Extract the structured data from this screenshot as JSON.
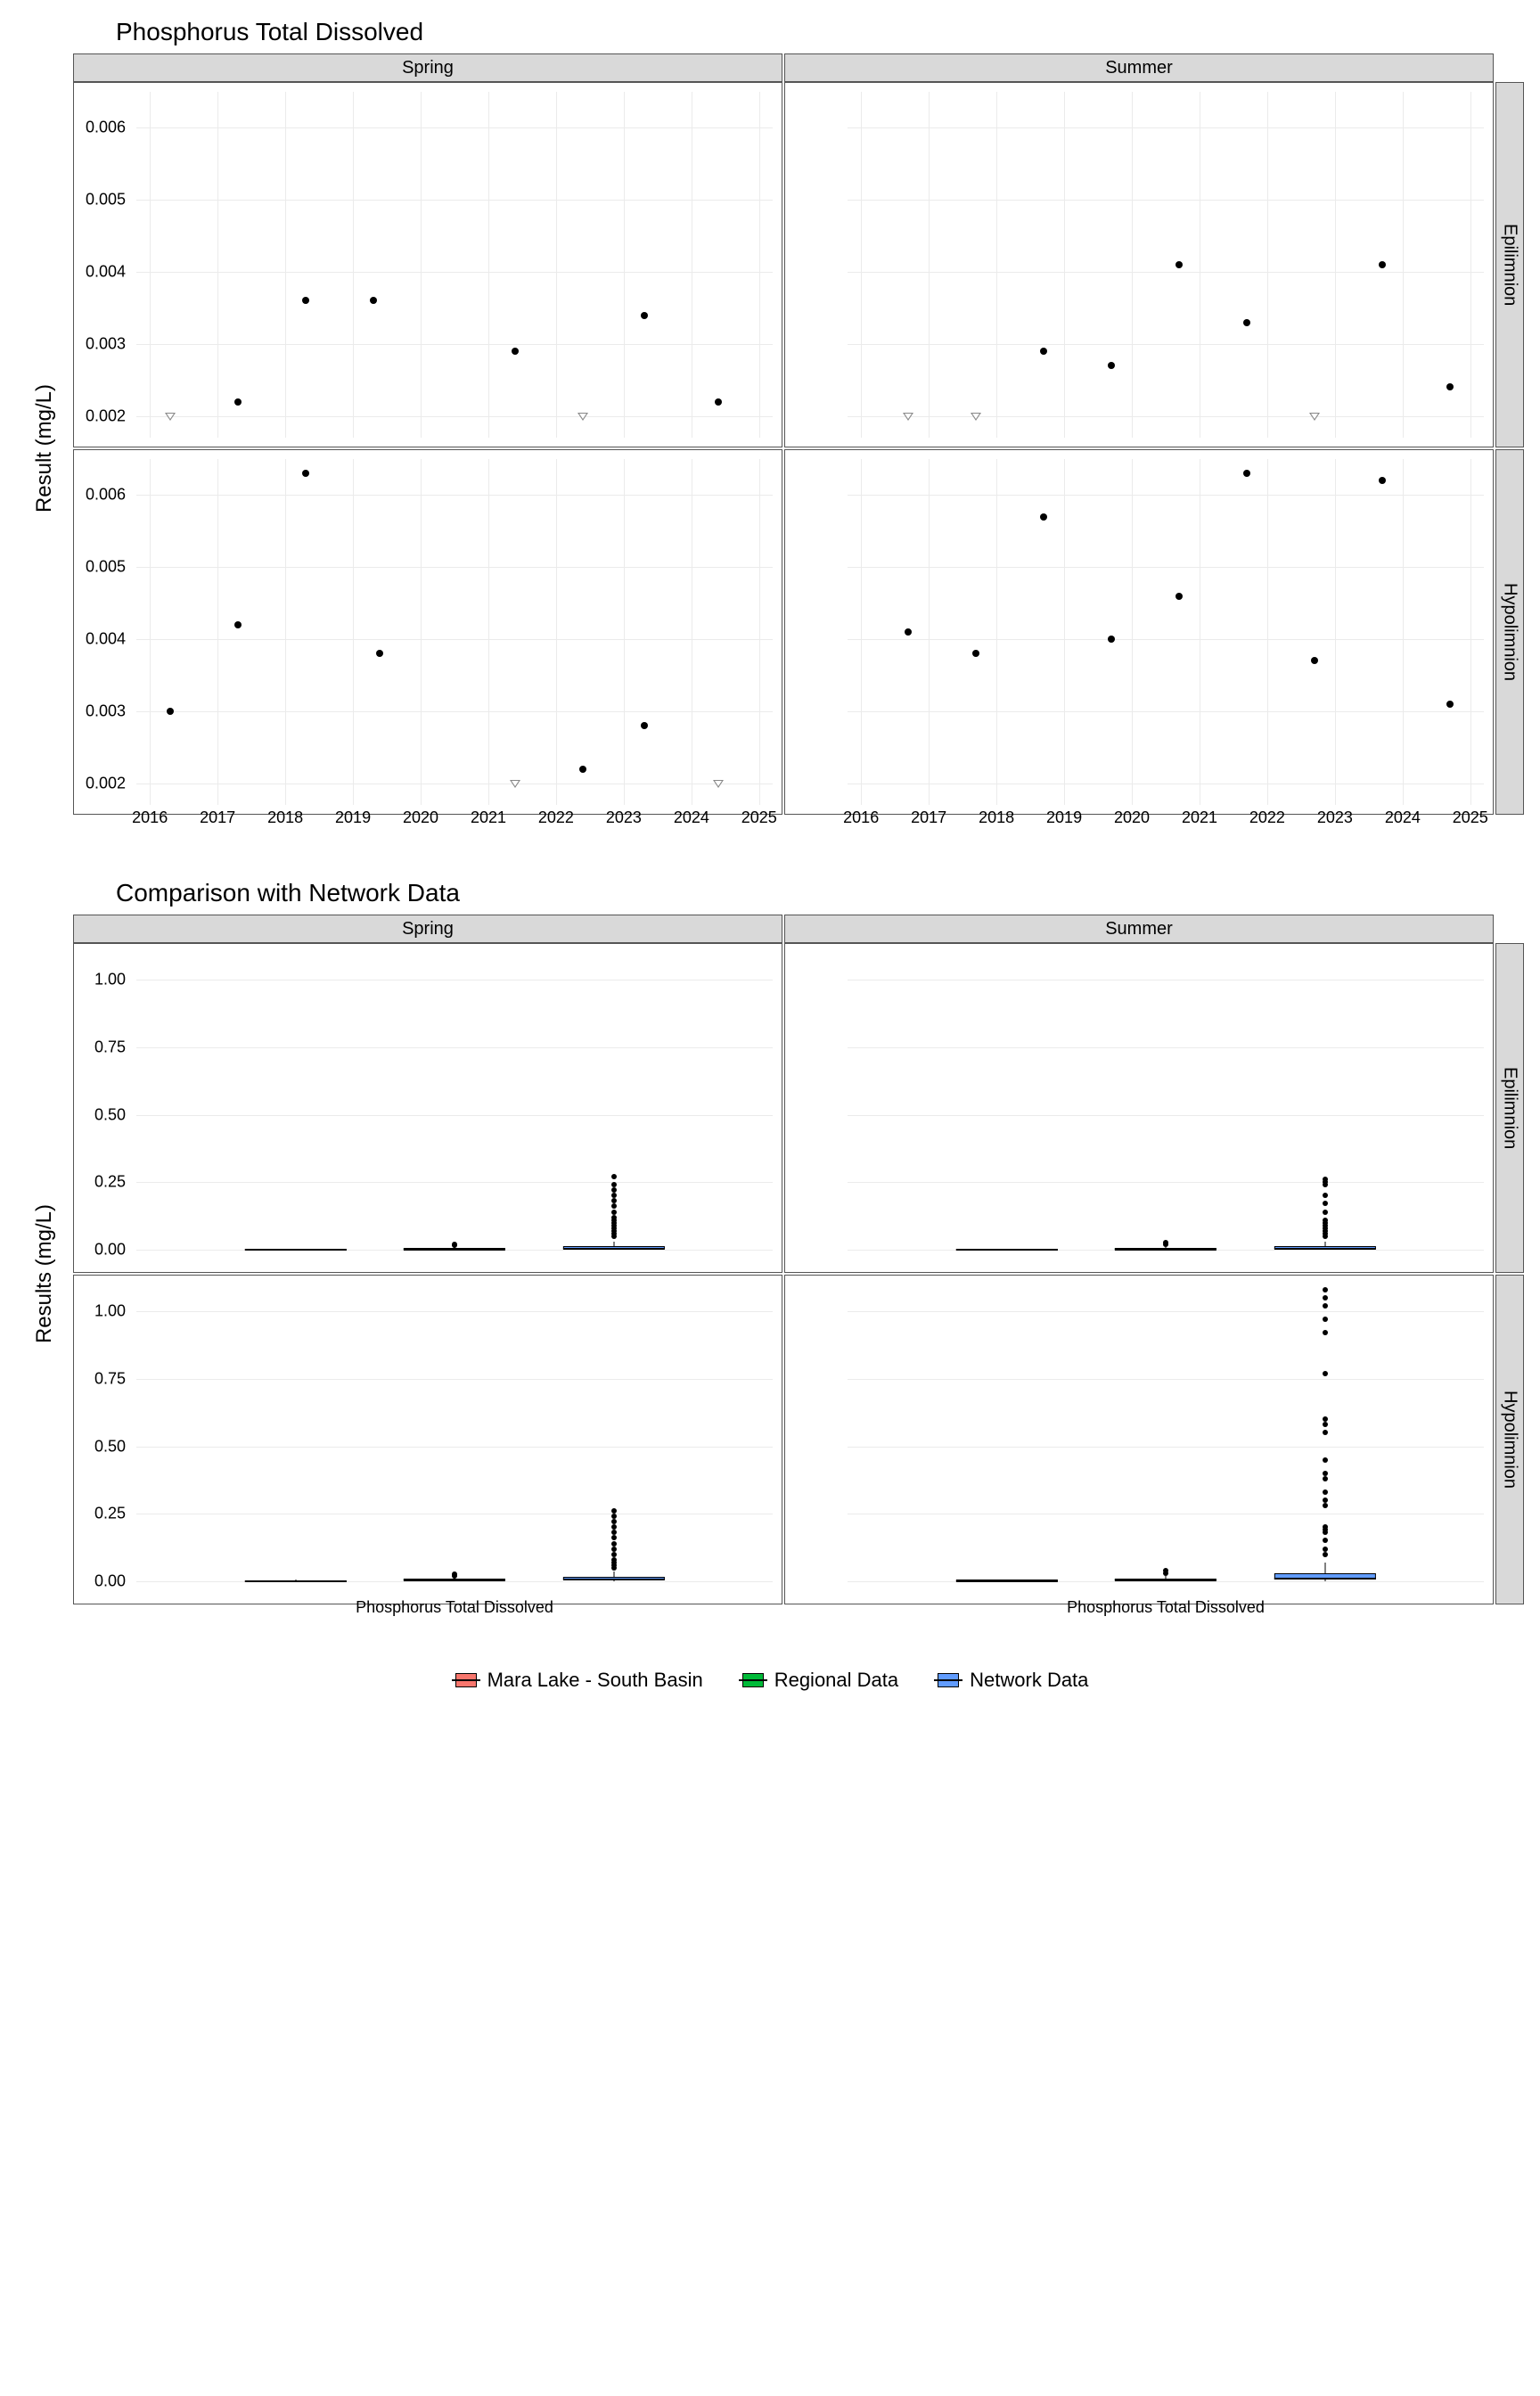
{
  "chart_data": [
    {
      "type": "scatter",
      "title": "Phosphorus Total Dissolved",
      "ylabel": "Result (mg/L)",
      "xlim": [
        2015.8,
        2025.2
      ],
      "x_ticks": [
        2016,
        2017,
        2018,
        2019,
        2020,
        2021,
        2022,
        2023,
        2024,
        2025
      ],
      "facets_cols": [
        "Spring",
        "Summer"
      ],
      "facets_rows": [
        "Epilimnion",
        "Hypolimnion"
      ],
      "ylim": [
        0.0017,
        0.0065
      ],
      "y_ticks": [
        0.002,
        0.003,
        0.004,
        0.005,
        0.006
      ],
      "panels": {
        "Spring|Epilimnion": {
          "points": [
            {
              "x": 2017.3,
              "y": 0.0022
            },
            {
              "x": 2018.3,
              "y": 0.0036
            },
            {
              "x": 2019.3,
              "y": 0.0036
            },
            {
              "x": 2021.4,
              "y": 0.0029
            },
            {
              "x": 2023.3,
              "y": 0.0034
            },
            {
              "x": 2024.4,
              "y": 0.0022
            }
          ],
          "censored": [
            {
              "x": 2016.3,
              "y": 0.002
            },
            {
              "x": 2022.4,
              "y": 0.002
            }
          ]
        },
        "Summer|Epilimnion": {
          "points": [
            {
              "x": 2018.7,
              "y": 0.0029
            },
            {
              "x": 2019.7,
              "y": 0.0027
            },
            {
              "x": 2020.7,
              "y": 0.0041
            },
            {
              "x": 2021.7,
              "y": 0.0033
            },
            {
              "x": 2023.7,
              "y": 0.0041
            },
            {
              "x": 2024.7,
              "y": 0.0024
            }
          ],
          "censored": [
            {
              "x": 2016.7,
              "y": 0.002
            },
            {
              "x": 2017.7,
              "y": 0.002
            },
            {
              "x": 2022.7,
              "y": 0.002
            }
          ]
        },
        "Spring|Hypolimnion": {
          "points": [
            {
              "x": 2016.3,
              "y": 0.003
            },
            {
              "x": 2017.3,
              "y": 0.0042
            },
            {
              "x": 2018.3,
              "y": 0.0063
            },
            {
              "x": 2019.4,
              "y": 0.0038
            },
            {
              "x": 2022.4,
              "y": 0.0022
            },
            {
              "x": 2023.3,
              "y": 0.0028
            }
          ],
          "censored": [
            {
              "x": 2021.4,
              "y": 0.002
            },
            {
              "x": 2024.4,
              "y": 0.002
            }
          ]
        },
        "Summer|Hypolimnion": {
          "points": [
            {
              "x": 2016.7,
              "y": 0.0041
            },
            {
              "x": 2017.7,
              "y": 0.0038
            },
            {
              "x": 2018.7,
              "y": 0.0057
            },
            {
              "x": 2019.7,
              "y": 0.004
            },
            {
              "x": 2020.7,
              "y": 0.0046
            },
            {
              "x": 2021.7,
              "y": 0.0063
            },
            {
              "x": 2022.7,
              "y": 0.0037
            },
            {
              "x": 2023.7,
              "y": 0.0062
            },
            {
              "x": 2024.7,
              "y": 0.0031
            }
          ],
          "censored": []
        }
      }
    },
    {
      "type": "boxplot",
      "title": "Comparison with Network Data",
      "ylabel": "Results (mg/L)",
      "x_category_label": "Phosphorus Total Dissolved",
      "facets_cols": [
        "Spring",
        "Summer"
      ],
      "facets_rows": [
        "Epilimnion",
        "Hypolimnion"
      ],
      "ylim": [
        -0.05,
        1.1
      ],
      "y_ticks": [
        0.0,
        0.25,
        0.5,
        0.75,
        1.0
      ],
      "groups": [
        "Mara Lake - South Basin",
        "Regional Data",
        "Network Data"
      ],
      "group_colors": {
        "Mara Lake - South Basin": "#F8766D",
        "Regional Data": "#00BA38",
        "Network Data": "#619CFF"
      },
      "panels": {
        "Spring|Epilimnion": {
          "boxes": [
            {
              "group": "Mara Lake - South Basin",
              "min": 0.002,
              "q1": 0.002,
              "med": 0.003,
              "q3": 0.0035,
              "max": 0.004,
              "outliers": []
            },
            {
              "group": "Regional Data",
              "min": 0.001,
              "q1": 0.003,
              "med": 0.004,
              "q3": 0.006,
              "max": 0.01,
              "outliers": [
                0.015,
                0.02
              ]
            },
            {
              "group": "Network Data",
              "min": 0.001,
              "q1": 0.004,
              "med": 0.006,
              "q3": 0.012,
              "max": 0.03,
              "outliers": [
                0.05,
                0.06,
                0.07,
                0.08,
                0.09,
                0.1,
                0.11,
                0.12,
                0.14,
                0.16,
                0.18,
                0.2,
                0.22,
                0.24,
                0.27
              ]
            }
          ]
        },
        "Summer|Epilimnion": {
          "boxes": [
            {
              "group": "Mara Lake - South Basin",
              "min": 0.002,
              "q1": 0.0024,
              "med": 0.003,
              "q3": 0.0035,
              "max": 0.0041,
              "outliers": []
            },
            {
              "group": "Regional Data",
              "min": 0.001,
              "q1": 0.003,
              "med": 0.004,
              "q3": 0.006,
              "max": 0.011,
              "outliers": [
                0.018,
                0.025
              ]
            },
            {
              "group": "Network Data",
              "min": 0.001,
              "q1": 0.004,
              "med": 0.007,
              "q3": 0.013,
              "max": 0.03,
              "outliers": [
                0.05,
                0.06,
                0.07,
                0.08,
                0.09,
                0.1,
                0.11,
                0.14,
                0.17,
                0.2,
                0.24,
                0.25,
                0.26
              ]
            }
          ]
        },
        "Spring|Hypolimnion": {
          "boxes": [
            {
              "group": "Mara Lake - South Basin",
              "min": 0.002,
              "q1": 0.0022,
              "med": 0.003,
              "q3": 0.004,
              "max": 0.0063,
              "outliers": []
            },
            {
              "group": "Regional Data",
              "min": 0.001,
              "q1": 0.003,
              "med": 0.005,
              "q3": 0.008,
              "max": 0.015,
              "outliers": [
                0.02,
                0.025
              ]
            },
            {
              "group": "Network Data",
              "min": 0.001,
              "q1": 0.005,
              "med": 0.008,
              "q3": 0.015,
              "max": 0.035,
              "outliers": [
                0.05,
                0.06,
                0.07,
                0.08,
                0.1,
                0.12,
                0.14,
                0.16,
                0.18,
                0.2,
                0.22,
                0.24,
                0.26
              ]
            }
          ]
        },
        "Summer|Hypolimnion": {
          "boxes": [
            {
              "group": "Mara Lake - South Basin",
              "min": 0.003,
              "q1": 0.0037,
              "med": 0.0041,
              "q3": 0.0057,
              "max": 0.0063,
              "outliers": []
            },
            {
              "group": "Regional Data",
              "min": 0.001,
              "q1": 0.004,
              "med": 0.006,
              "q3": 0.01,
              "max": 0.02,
              "outliers": [
                0.03,
                0.04
              ]
            },
            {
              "group": "Network Data",
              "min": 0.001,
              "q1": 0.006,
              "med": 0.012,
              "q3": 0.03,
              "max": 0.07,
              "outliers": [
                0.1,
                0.12,
                0.15,
                0.18,
                0.19,
                0.2,
                0.28,
                0.3,
                0.33,
                0.38,
                0.4,
                0.45,
                0.55,
                0.58,
                0.6,
                0.77,
                0.92,
                0.97,
                1.02,
                1.05,
                1.08
              ]
            }
          ]
        }
      }
    }
  ],
  "legend": {
    "items": [
      {
        "label": "Mara Lake - South Basin",
        "color": "#F8766D"
      },
      {
        "label": "Regional Data",
        "color": "#00BA38"
      },
      {
        "label": "Network Data",
        "color": "#619CFF"
      }
    ]
  }
}
